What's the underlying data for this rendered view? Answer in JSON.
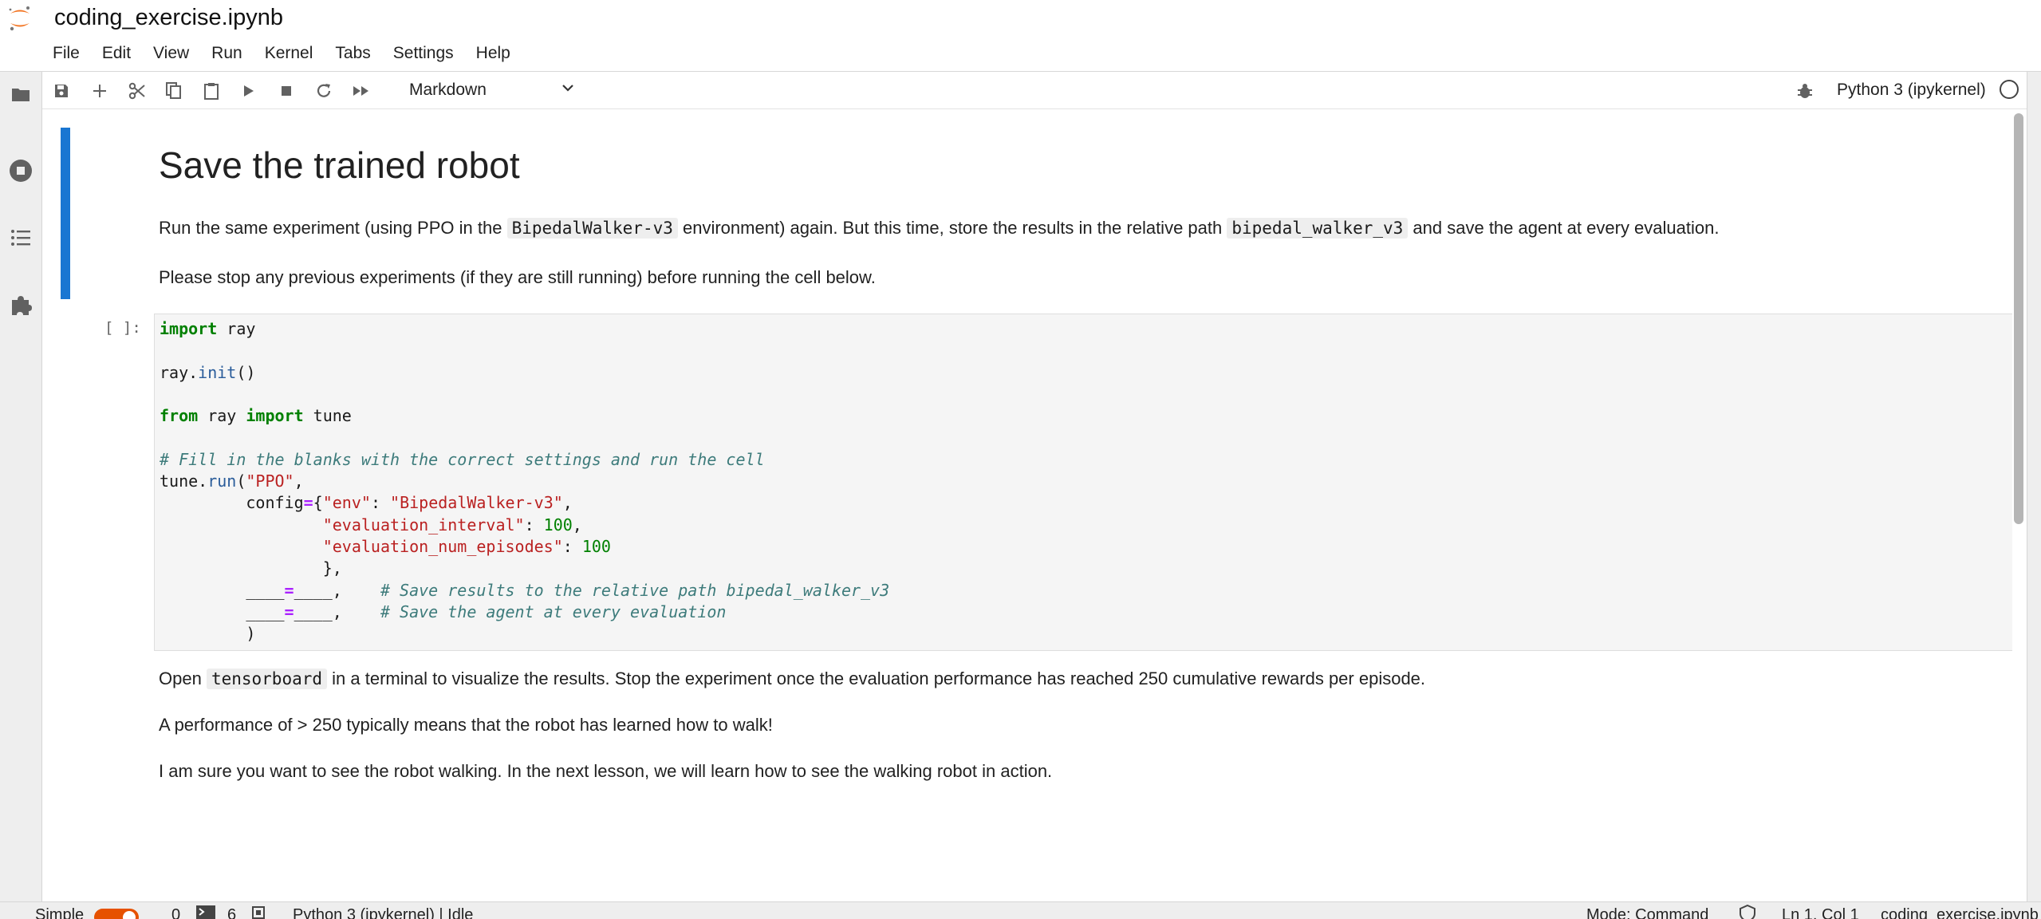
{
  "header": {
    "title": "coding_exercise.ipynb",
    "brand_color": "#F37726"
  },
  "menu": [
    "File",
    "Edit",
    "View",
    "Run",
    "Kernel",
    "Tabs",
    "Settings",
    "Help"
  ],
  "sidebar_left": [
    {
      "icon": "folder-icon"
    },
    {
      "icon": "running-stop-icon"
    },
    {
      "icon": "table-of-contents-icon"
    },
    {
      "icon": "extension-puzzle-icon"
    }
  ],
  "toolbar": {
    "buttons": [
      "save-icon",
      "add-cell-icon",
      "cut-icon",
      "copy-icon",
      "paste-icon",
      "run-icon",
      "stop-icon",
      "restart-icon",
      "run-all-icon"
    ],
    "cell_type": "Markdown",
    "kernel": "Python 3 (ipykernel)"
  },
  "cells": {
    "md1": {
      "heading": "Save the trained robot",
      "p1_a": "Run the same experiment (using PPO in the",
      "p1_code1": "BipedalWalker-v3",
      "p1_b": "environment) again. But this time, store the results in the relative path",
      "p1_code2": "bipedal_walker_v3",
      "p1_c": "and save the agent at every evaluation.",
      "p2": "Please stop any previous experiments (if they are still running) before running the cell below."
    },
    "code1": {
      "prompt": "[ ]:",
      "source": [
        "import ray",
        "",
        "ray.init()",
        "",
        "from ray import tune",
        "",
        "# Fill in the blanks with the correct settings and run the cell",
        "tune.run(\"PPO\",",
        "         config={\"env\": \"BipedalWalker-v3\",",
        "                 \"evaluation_interval\": 100,",
        "                 \"evaluation_num_episodes\": 100",
        "                 },",
        "         ____=____,    # Save results to the relative path bipedal_walker_v3",
        "         ____=____,    # Save the agent at every evaluation",
        "         )"
      ]
    },
    "md2": {
      "p1_a": "Open",
      "p1_code": "tensorboard",
      "p1_b": "in a terminal to visualize the results. Stop the experiment once the evaluation performance has reached 250 cumulative rewards per episode.",
      "p2": "A performance of > 250 typically means that the robot has learned how to walk!",
      "p3": "I am sure you want to see the robot walking. In the next lesson, we will learn how to see the walking robot in action."
    }
  },
  "statusbar": {
    "mode_label": "Simple",
    "terminals": "0",
    "kernels": "6",
    "kernel_status": "Python 3 (ipykernel) | Idle",
    "mode": "Mode: Command",
    "position": "Ln 1, Col 1",
    "filename": "coding_exercise.ipynb"
  }
}
